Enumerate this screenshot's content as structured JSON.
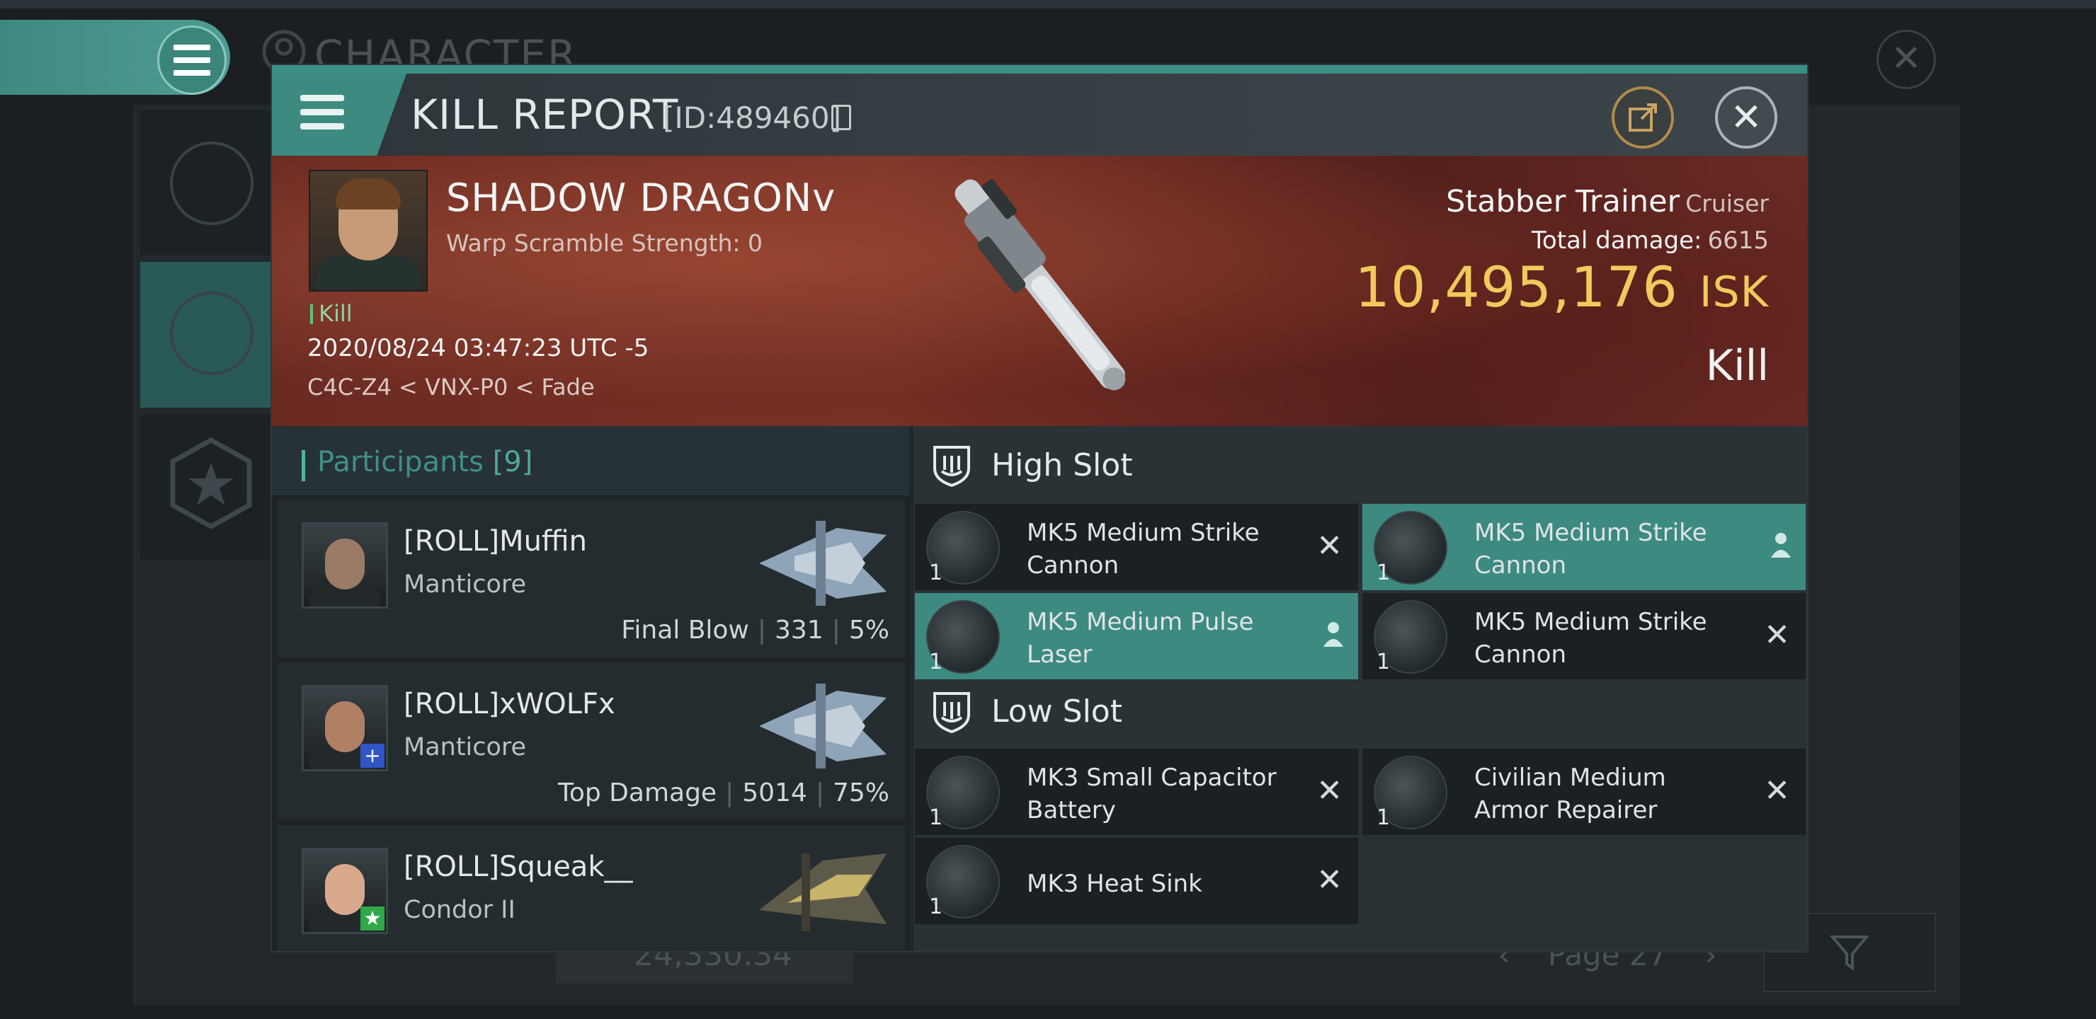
{
  "background": {
    "title": "CHARACTER",
    "balance_value": "24,330.34",
    "page_label": "Page 27"
  },
  "modal": {
    "title": "KILL REPORT",
    "report_id": "[ID:489460]",
    "victim": {
      "name": "SHADOW DRAGONv",
      "warp_scramble": "Warp Scramble Strength: 0",
      "tag": "Kill",
      "datetime": "2020/08/24 03:47:23 UTC -5",
      "location": "C4C-Z4 < VNX-P0 < Fade"
    },
    "ship": {
      "name": "Stabber Trainer",
      "class": "Cruiser",
      "total_damage_label": "Total damage:",
      "total_damage_value": "6615",
      "isk_value": "10,495,176",
      "isk_unit": "ISK",
      "result": "Kill"
    },
    "participants": {
      "label": "Participants",
      "count": "[9]",
      "items": [
        {
          "name": "[ROLL]Muffin",
          "ship": "Manticore",
          "stat_label": "Final Blow",
          "damage": "331",
          "percent": "5%",
          "face_color": "#9b7a66",
          "badge": ""
        },
        {
          "name": "[ROLL]xWOLFx",
          "ship": "Manticore",
          "stat_label": "Top Damage",
          "damage": "5014",
          "percent": "75%",
          "face_color": "#b08064",
          "badge": "+"
        },
        {
          "name": "[ROLL]Squeak__",
          "ship": "Condor II",
          "stat_label": "",
          "damage": "",
          "percent": "",
          "face_color": "#d9a98e",
          "badge": "★"
        }
      ]
    },
    "fitting": {
      "high_slot_label": "High Slot",
      "low_slot_label": "Low Slot",
      "high": [
        {
          "name": "MK5 Medium Strike Cannon",
          "qty": "1",
          "state": "destroyed"
        },
        {
          "name": "MK5 Medium Strike Cannon",
          "qty": "1",
          "state": "dropped"
        },
        {
          "name": "MK5 Medium Pulse Laser",
          "qty": "1",
          "state": "dropped"
        },
        {
          "name": "MK5 Medium Strike Cannon",
          "qty": "1",
          "state": "destroyed"
        }
      ],
      "low": [
        {
          "name": "MK3 Small Capacitor Battery",
          "qty": "1",
          "state": "destroyed"
        },
        {
          "name": "Civilian Medium Armor Repairer",
          "qty": "1",
          "state": "destroyed"
        },
        {
          "name": "MK3 Heat Sink",
          "qty": "1",
          "state": "destroyed"
        }
      ]
    }
  },
  "colors": {
    "accent": "#3d8a80",
    "isk": "#f2c95c",
    "banner": "#7b3227"
  },
  "icons": [
    "menu-icon",
    "copy-icon",
    "share-icon",
    "close-icon",
    "shield-slot-icon",
    "person-icon",
    "filter-icon",
    "star-badge-icon",
    "plus-badge-icon"
  ]
}
